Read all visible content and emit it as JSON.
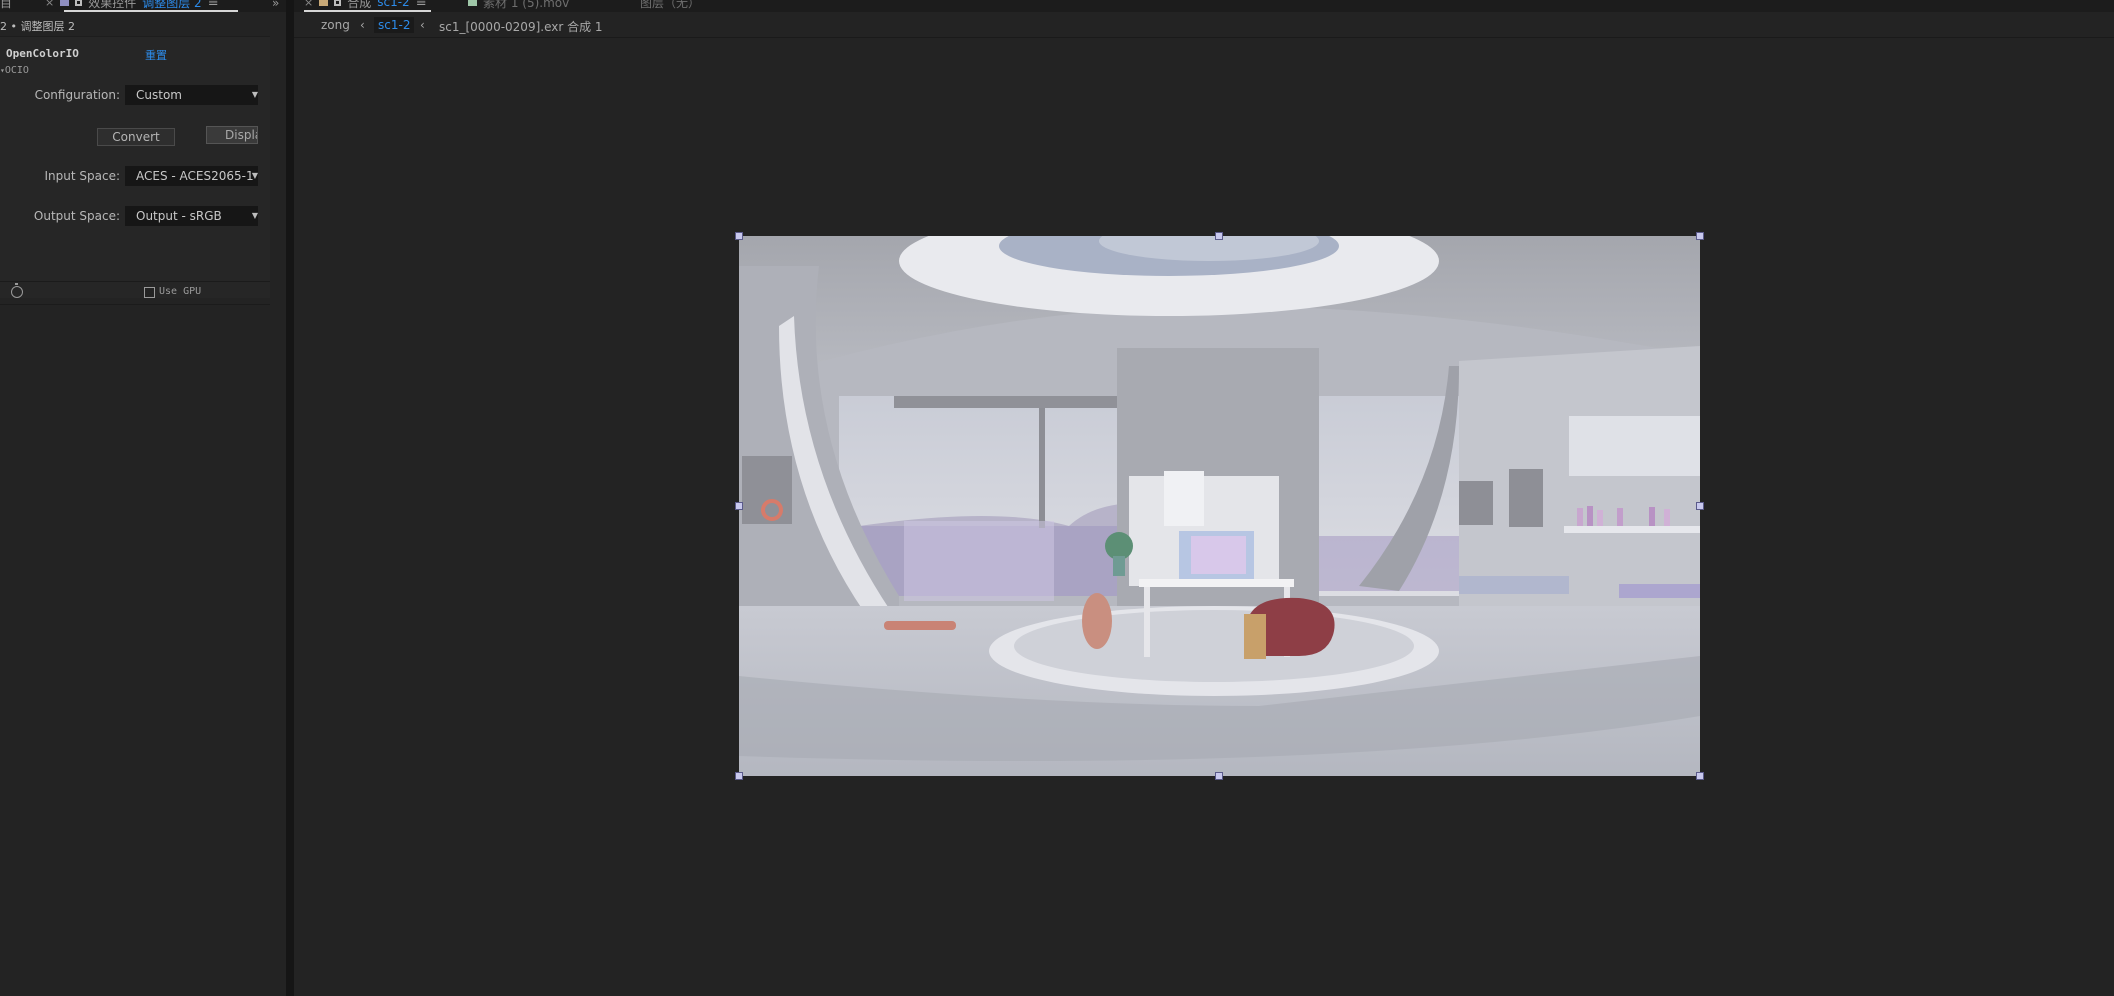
{
  "tabs": {
    "effects": {
      "close": "×",
      "title": "效果控件",
      "layer": "调整图层 2",
      "menu": "≡"
    },
    "overflow": "»",
    "composition": {
      "close": "×",
      "title": "合成",
      "name": "sc1-2",
      "menu": "≡"
    },
    "footage": {
      "title": "素材 1 (5).mov"
    },
    "layer": {
      "title": "图层（无）"
    }
  },
  "left_panel": {
    "subtitle": "2 • 调整图层 2",
    "effect_name": "OpenColorIO",
    "reset": "重置",
    "ocio_label": "OCIO",
    "configuration": {
      "label": "Configuration:",
      "value": "Custom"
    },
    "convert_button": "Convert",
    "display_button": "Displa",
    "input_space": {
      "label": "Input Space:",
      "value": "ACES - ACES2065-1"
    },
    "output_space": {
      "label": "Output Space:",
      "value": "Output - sRGB"
    },
    "use_gpu": "Use GPU"
  },
  "breadcrumbs": [
    "zong",
    "sc1-2",
    "sc1_[0000-0209].exr 合成 1"
  ],
  "colors": {
    "accent": "#2d8ceb",
    "panel_bg": "#232323",
    "handle": "#c9c9ee"
  }
}
